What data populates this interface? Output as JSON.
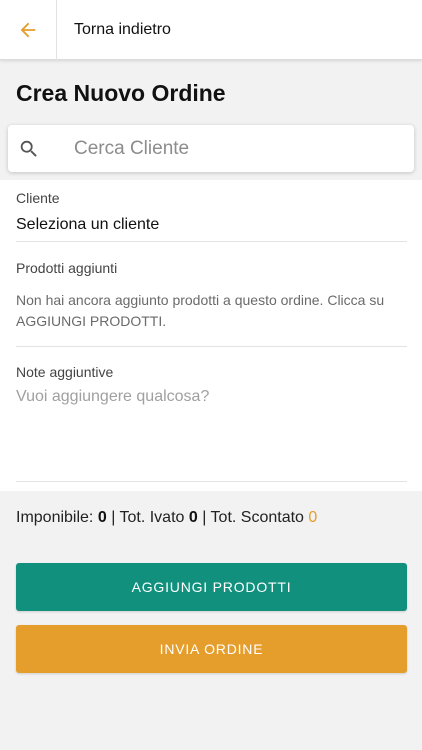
{
  "header": {
    "back_label": "Torna indietro"
  },
  "page": {
    "title": "Crea Nuovo Ordine"
  },
  "search": {
    "placeholder": "Cerca Cliente",
    "value": ""
  },
  "client": {
    "label": "Cliente",
    "value": "Seleziona un cliente"
  },
  "products": {
    "label": "Prodotti aggiunti",
    "empty_message": "Non hai ancora aggiunto prodotti a questo ordine. Clicca su AGGIUNGI PRODOTTI."
  },
  "notes": {
    "label": "Note aggiuntive",
    "placeholder": "Vuoi aggiungere qualcosa?",
    "value": ""
  },
  "totals": {
    "imponibile_label": "Imponibile:",
    "imponibile_value": "0",
    "sep1": "|",
    "ivato_label": "Tot. Ivato",
    "ivato_value": "0",
    "sep2": "|",
    "scontato_label": "Tot. Scontato",
    "scontato_value": "0"
  },
  "actions": {
    "add_products_label": "AGGIUNGI PRODOTTI",
    "send_order_label": "INVIA ORDINE"
  },
  "colors": {
    "accent": "#e59d2c",
    "primary": "#11907d",
    "background": "#f2f2f2"
  },
  "icons": {
    "back": "arrow-left-icon",
    "search": "search-icon"
  }
}
